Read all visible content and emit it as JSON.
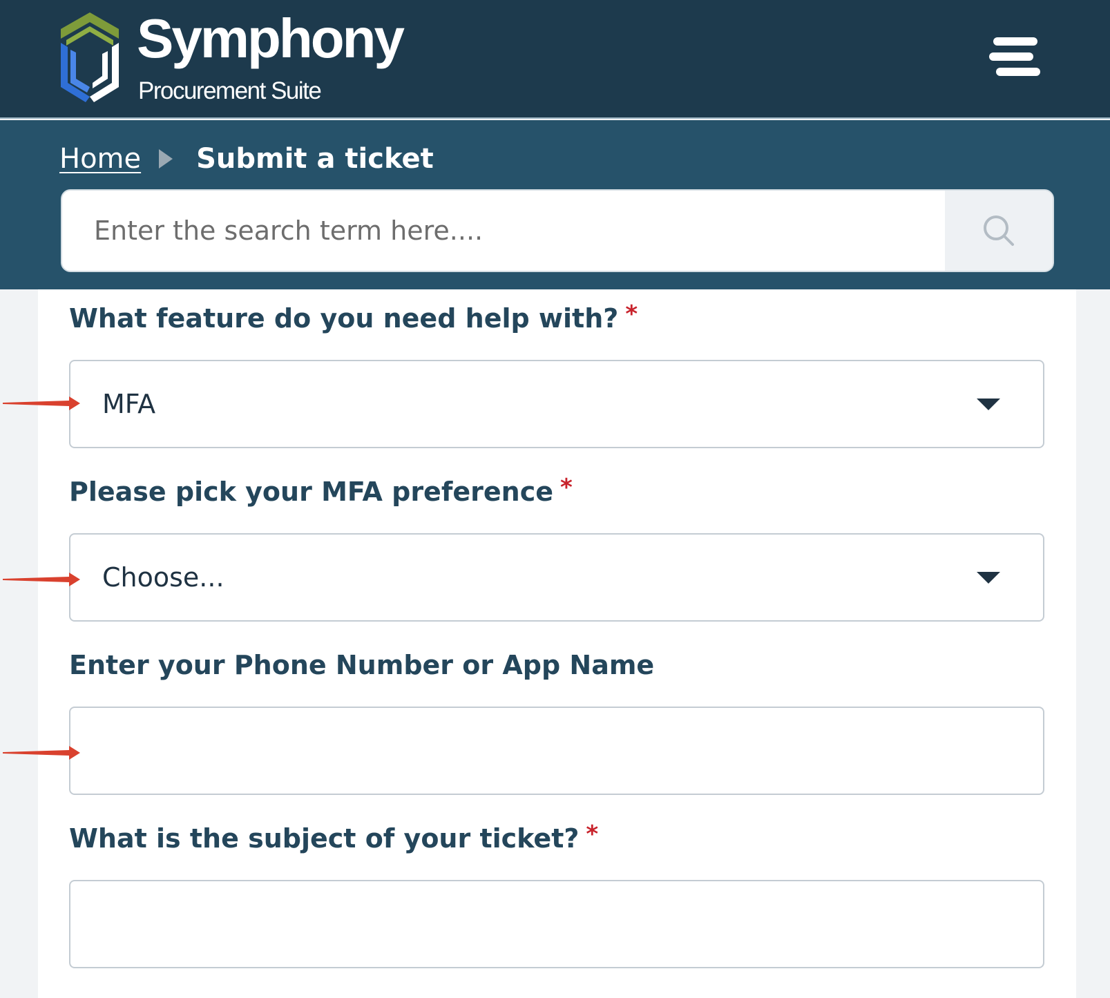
{
  "header": {
    "logo": {
      "name": "Symphony",
      "subtitle": "Procurement Suite",
      "colors": {
        "green": "#7e9b3a",
        "blue": "#2f6fd6",
        "white": "#ffffff"
      }
    },
    "menu_icon": "hamburger-menu-icon"
  },
  "breadcrumb": {
    "home": "Home",
    "separator_icon": "caret-right-icon",
    "current": "Submit a ticket"
  },
  "search": {
    "placeholder": "Enter the search term here....",
    "button_icon": "search-icon"
  },
  "form": {
    "feature": {
      "label": "What feature do you need help with?",
      "required_mark": "*",
      "value": "MFA"
    },
    "mfa_preference": {
      "label": "Please pick your MFA preference",
      "required_mark": "*",
      "value": "Choose..."
    },
    "phone_or_app": {
      "label": "Enter your Phone Number or App Name",
      "value": ""
    },
    "subject": {
      "label": "What is the subject of your ticket?",
      "required_mark": "*",
      "value": ""
    }
  },
  "annotations": {
    "arrow_color": "#d9412e",
    "arrow_icon": "red-arrow-icon"
  },
  "colors": {
    "header_bg": "#1d3a4d",
    "subbar_bg": "#26526a",
    "label_text": "#24465b",
    "required": "#c8232c",
    "page_bg": "#f1f3f5"
  }
}
